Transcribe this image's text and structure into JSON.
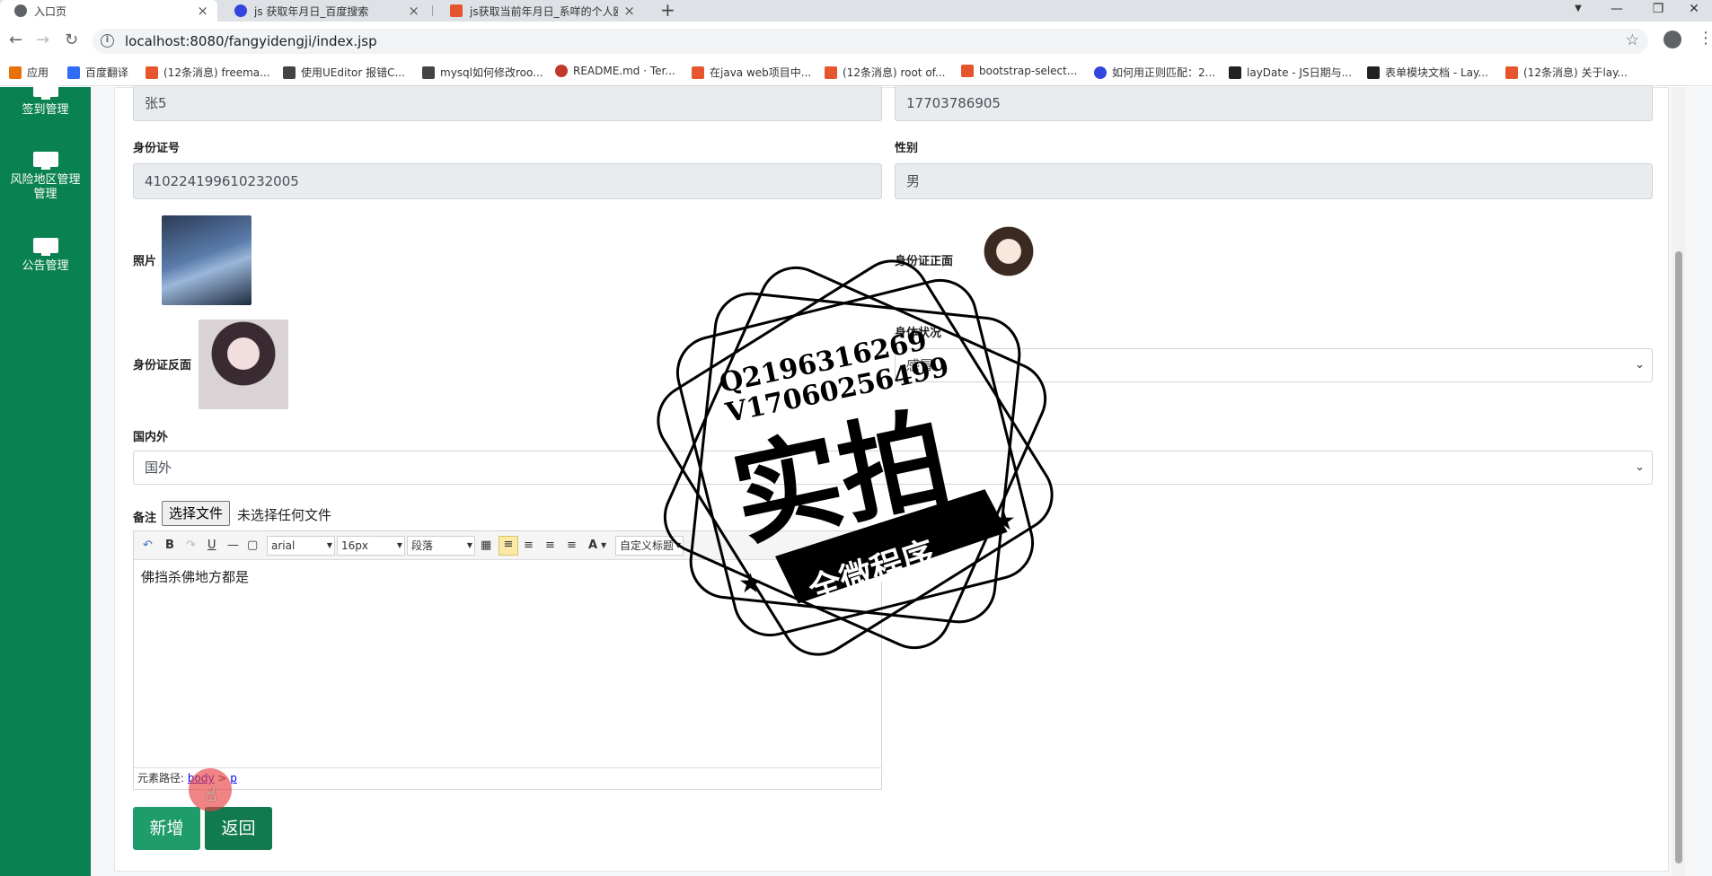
{
  "browser": {
    "tabs": [
      {
        "title": "入口页",
        "color": "#5f6368"
      },
      {
        "title": "js 获取年月日_百度搜索",
        "color": "#3245df"
      },
      {
        "title": "js获取当前年月日_系咩的个人欧尔",
        "color": "#e5552e"
      }
    ],
    "new_tab": "+",
    "window_controls": {
      "minimize": "—",
      "restore": "❐",
      "close": "✕"
    },
    "url": "localhost:8080/fangyidengji/index.jsp",
    "bookmarks": [
      {
        "label": "应用",
        "color": "#e8710a"
      },
      {
        "label": "百度翻译",
        "color": "#2f6cf5"
      },
      {
        "label": "(12条消息) freema...",
        "color": "#e5552e"
      },
      {
        "label": "使用UEditor 报错C...",
        "color": "#444444"
      },
      {
        "label": "mysql如何修改roo...",
        "color": "#444444"
      },
      {
        "label": "README.md · Ter...",
        "color": "#c0392b"
      },
      {
        "label": "在java web项目中...",
        "color": "#e5552e"
      },
      {
        "label": "(12条消息) root of...",
        "color": "#e5552e"
      },
      {
        "label": "bootstrap-select...",
        "color": "#e5552e"
      },
      {
        "label": "如何用正则匹配：2...",
        "color": "#3245df"
      },
      {
        "label": "layDate - JS日期与...",
        "color": "#222222"
      },
      {
        "label": "表单模块文档 - Lay...",
        "color": "#222222"
      },
      {
        "label": "(12条消息) 关于lay...",
        "color": "#e5552e"
      }
    ]
  },
  "sidebar": {
    "items": [
      {
        "label": "签到管理"
      },
      {
        "label": "风险地区管理",
        "label2": "管理"
      },
      {
        "label": "公告管理"
      }
    ]
  },
  "form": {
    "name_value": "张5",
    "phone_value": "17703786905",
    "id_label": "身份证号",
    "id_value": "410224199610232005",
    "gender_label": "性别",
    "gender_value": "男",
    "photo_label": "照片",
    "id_front_label": "身份证正面",
    "id_back_label": "身份证反面",
    "health_label": "身体状况",
    "health_value": "感冒",
    "domestic_label": "国内外",
    "domestic_value": "国外",
    "notes_label": "备注",
    "file_button": "选择文件",
    "file_status": "未选择任何文件"
  },
  "editor": {
    "toolbar": {
      "font": "arial",
      "size": "16px",
      "paragraph": "段落",
      "custom_title": "自定义标题"
    },
    "content": "佛挡杀佛地方都是",
    "path_label": "元素路径:",
    "path_body": "body",
    "path_sep": ">",
    "path_p": "p"
  },
  "buttons": {
    "add": "新增",
    "back": "返回"
  },
  "watermark": {
    "qq": "Q2196316269",
    "wechat": "V17060256499",
    "big": "实拍",
    "ribbon": "全微程序"
  }
}
